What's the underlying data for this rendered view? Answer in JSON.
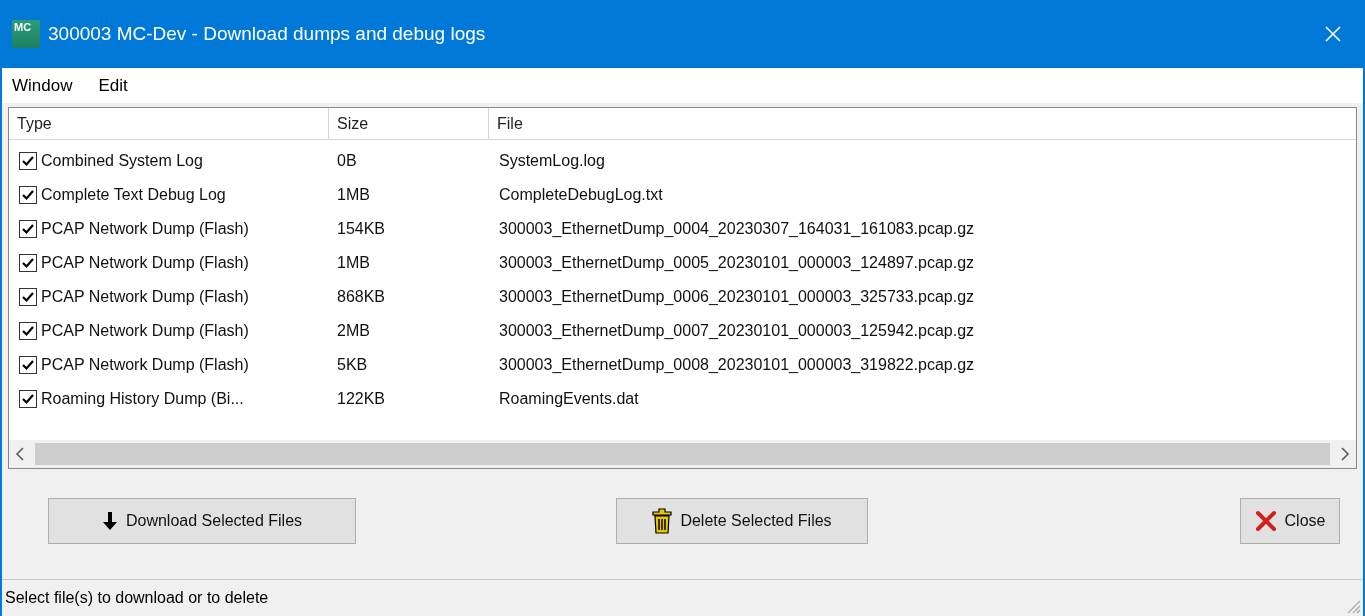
{
  "window": {
    "logo": "MC",
    "title": "300003 MC-Dev - Download dumps and debug logs"
  },
  "menu": [
    "Window",
    "Edit"
  ],
  "table": {
    "columns": [
      "Type",
      "Size",
      "File"
    ],
    "rows": [
      {
        "checked": true,
        "type": "Combined System Log",
        "size": "0B",
        "file": "SystemLog.log"
      },
      {
        "checked": true,
        "type": "Complete Text Debug Log",
        "size": "1MB",
        "file": "CompleteDebugLog.txt"
      },
      {
        "checked": true,
        "type": "PCAP Network Dump (Flash)",
        "size": "154KB",
        "file": "300003_EthernetDump_0004_20230307_164031_161083.pcap.gz"
      },
      {
        "checked": true,
        "type": "PCAP Network Dump (Flash)",
        "size": "1MB",
        "file": "300003_EthernetDump_0005_20230101_000003_124897.pcap.gz"
      },
      {
        "checked": true,
        "type": "PCAP Network Dump (Flash)",
        "size": "868KB",
        "file": "300003_EthernetDump_0006_20230101_000003_325733.pcap.gz"
      },
      {
        "checked": true,
        "type": "PCAP Network Dump (Flash)",
        "size": "2MB",
        "file": "300003_EthernetDump_0007_20230101_000003_125942.pcap.gz"
      },
      {
        "checked": true,
        "type": "PCAP Network Dump (Flash)",
        "size": "5KB",
        "file": "300003_EthernetDump_0008_20230101_000003_319822.pcap.gz"
      },
      {
        "checked": true,
        "type": "Roaming History Dump (Bi...",
        "size": "122KB",
        "file": "RoamingEvents.dat"
      }
    ]
  },
  "buttons": [
    {
      "kind": "download",
      "label": "Download Selected Files"
    },
    {
      "kind": "delete",
      "label": "Delete Selected Files"
    },
    {
      "kind": "close",
      "label": "Close"
    }
  ],
  "status_bar": "Select file(s) to download or to delete"
}
